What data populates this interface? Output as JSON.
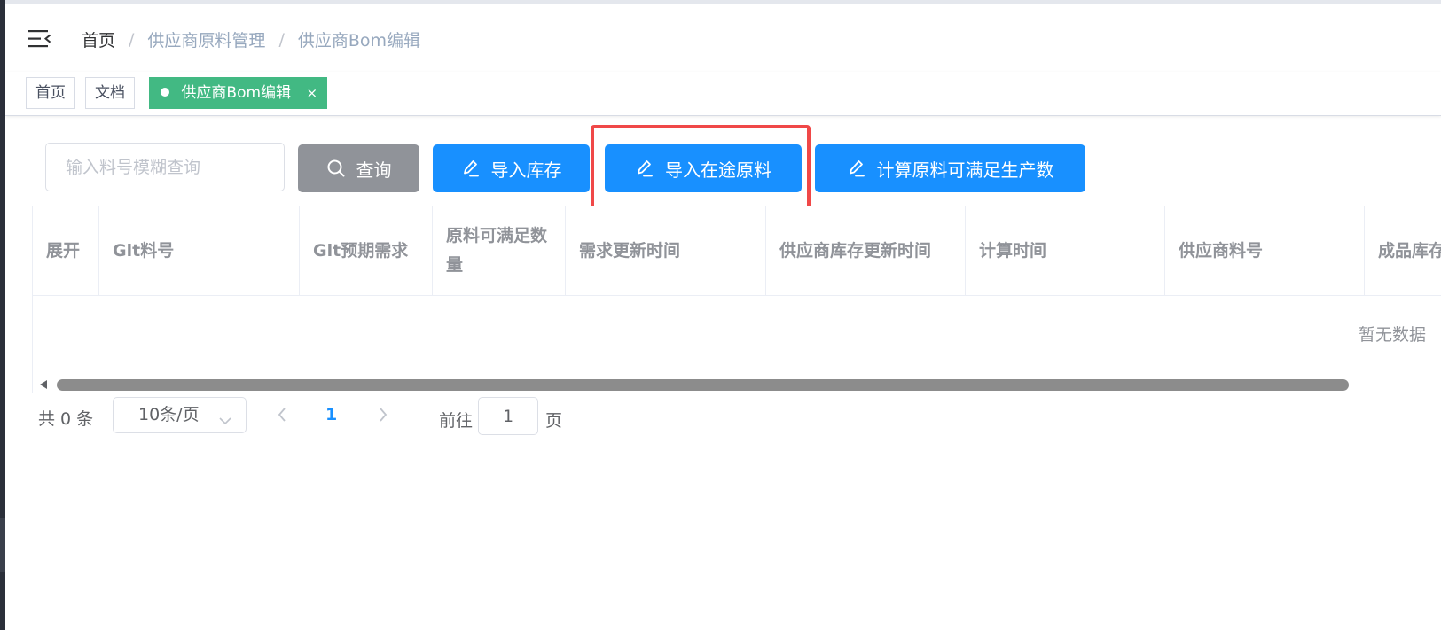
{
  "breadcrumb": {
    "items": [
      "首页",
      "供应商原料管理",
      "供应商Bom编辑"
    ],
    "separator": "/"
  },
  "tags": [
    {
      "label": "首页"
    },
    {
      "label": "文档"
    },
    {
      "label": "供应商Bom编辑",
      "close": "×",
      "active": true
    }
  ],
  "toolbar": {
    "search_placeholder": "输入料号模糊查询",
    "query_label": "查询",
    "import_inventory_label": "导入库存",
    "import_transit_label": "导入在途原料",
    "calculate_label": "计算原料可满足生产数"
  },
  "table": {
    "columns": [
      "展开",
      "Glt料号",
      "Glt预期需求",
      "原料可满足数量",
      "需求更新时间",
      "供应商库存更新时间",
      "计算时间",
      "供应商料号",
      "成品库存"
    ],
    "empty_text": "暂无数据"
  },
  "pagination": {
    "total_text": "共 0 条",
    "page_size_label": "10条/页",
    "current_page": "1",
    "goto_label": "前往",
    "goto_value": "1",
    "page_suffix": "页"
  },
  "colors": {
    "primary": "#1890ff",
    "active_tag": "#42b983",
    "query_button": "#909399",
    "highlight": "#f04848"
  },
  "icons": [
    "hamburger-icon",
    "search-icon",
    "edit-icon",
    "close-icon",
    "chevron-down-icon",
    "chevron-left-icon",
    "chevron-right-icon"
  ]
}
